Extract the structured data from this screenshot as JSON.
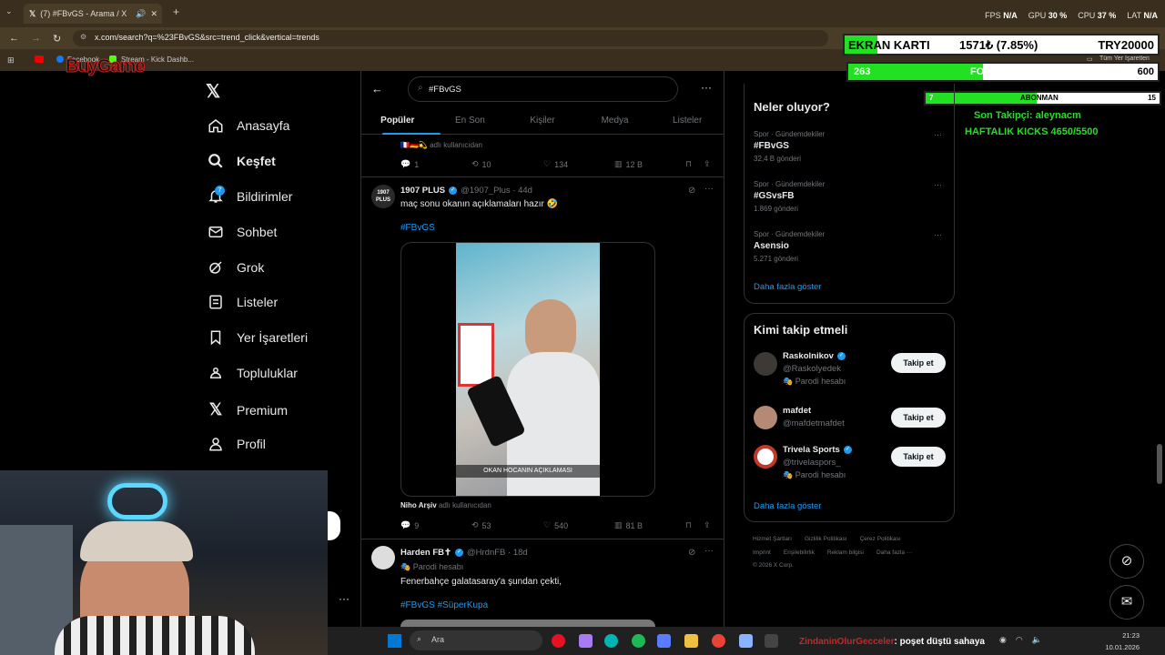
{
  "browser": {
    "tab_title": "(7) #FBvGS - Arama / X",
    "url": "x.com/search?q=%23FBvGS&src=trend_click&vertical=trends",
    "bookmarks": [
      "Facebook",
      "Stream - Kick Dashb..."
    ],
    "bookmarks_right": "Tüm Yer İşaretleri"
  },
  "perf": {
    "fps_label": "FPS",
    "fps": "N/A",
    "gpu_label": "GPU",
    "gpu": "30 %",
    "cpu_label": "CPU",
    "cpu": "37 %",
    "lat_label": "LAT",
    "lat": "N/A"
  },
  "overlay": {
    "logo": "BuyGame",
    "gpu_label": "EKRAN KARTI",
    "gpu_val": "1571₺ (7.85%)",
    "gpu_goal": "TRY20000",
    "gpu_progress": 0.0785,
    "followers_cur": "263",
    "followers_label": "FOLLOWERS",
    "followers_goal": "600",
    "followers_progress": 0.438,
    "sub_cur": "7",
    "sub_label": "ABONMAN",
    "sub_goal": "15",
    "sub_progress": 0.467,
    "last_follower": "Son Takipçi: aleynacm",
    "weekly": "HAFTALIK KICKS 4650/5500"
  },
  "nav": [
    "Anasayfa",
    "Keşfet",
    "Bildirimler",
    "Sohbet",
    "Grok",
    "Listeler",
    "Yer İşaretleri",
    "Topluluklar",
    "Premium",
    "Profil"
  ],
  "nav_badge": "7",
  "search": {
    "value": "#FBvGS"
  },
  "tabs": [
    "Popüler",
    "En Son",
    "Kişiler",
    "Medya",
    "Listeler"
  ],
  "tweet0": {
    "source": "adlı kullanıcıdan",
    "replies": "1",
    "retweets": "10",
    "likes": "134",
    "views": "12 B"
  },
  "tweet1": {
    "name": "1907 PLUS",
    "handle": "@1907_Plus · 44d",
    "avatar": "1907 PLUS",
    "text": "maç sonu okanın açıklamaları hazır 🤣",
    "hashtag": "#FBvGS",
    "video_caption": "OKAN HOCANIN AÇIKLAMASI",
    "source_name": "Niho Arşiv",
    "source_suffix": "adlı kullanıcıdan",
    "replies": "9",
    "retweets": "53",
    "likes": "540",
    "views": "81 B"
  },
  "tweet2": {
    "name": "Harden FB✝",
    "handle": "@HrdnFB · 18d",
    "parody": "Parodi hesabı",
    "text": "Fenerbahçe galatasaray'a şundan çekti,",
    "hashtags": "#FBvGS #SüperKupa"
  },
  "trends": {
    "title": "Neler oluyor?",
    "items": [
      {
        "meta": "Spor · Gündemdekiler",
        "name": "#FBvGS",
        "count": "32,4 B gönderi"
      },
      {
        "meta": "Spor · Gündemdekiler",
        "name": "#GSvsFB",
        "count": "1.869 gönderi"
      },
      {
        "meta": "Spor · Gündemdekiler",
        "name": "Asensio",
        "count": "5.271 gönderi"
      }
    ],
    "more": "Daha fazla göster"
  },
  "who": {
    "title": "Kimi takip etmeli",
    "items": [
      {
        "name": "Raskolnikov",
        "handle": "@Raskolyedek",
        "parody": "Parodi hesabı",
        "btn": "Takip et"
      },
      {
        "name": "mafdet",
        "handle": "@mafdetmafdet",
        "btn": "Takip et"
      },
      {
        "name": "Trivela Sports",
        "handle": "@trivelaspors_",
        "parody": "Parodi hesabı",
        "btn": "Takip et"
      }
    ],
    "more": "Daha fazla göster"
  },
  "footer": {
    "line1": [
      "Hizmet Şartları",
      "Gizlilik Politikası",
      "Çerez Politikası"
    ],
    "line2": [
      "Imprint",
      "Erişilebilirlik",
      "Reklam bilgisi",
      "Daha fazla ···"
    ],
    "copy": "© 2026 X Corp."
  },
  "taskbar": {
    "search": "Ara",
    "time": "21:23",
    "date": "10.01.2026",
    "ticker_user": "ZindaninOlurGecceler",
    "ticker_msg": ": poşet düştü sahaya"
  },
  "colors": {
    "accent": "#1d9bf0",
    "overlay_green": "#22e022",
    "bg": "#000000"
  }
}
